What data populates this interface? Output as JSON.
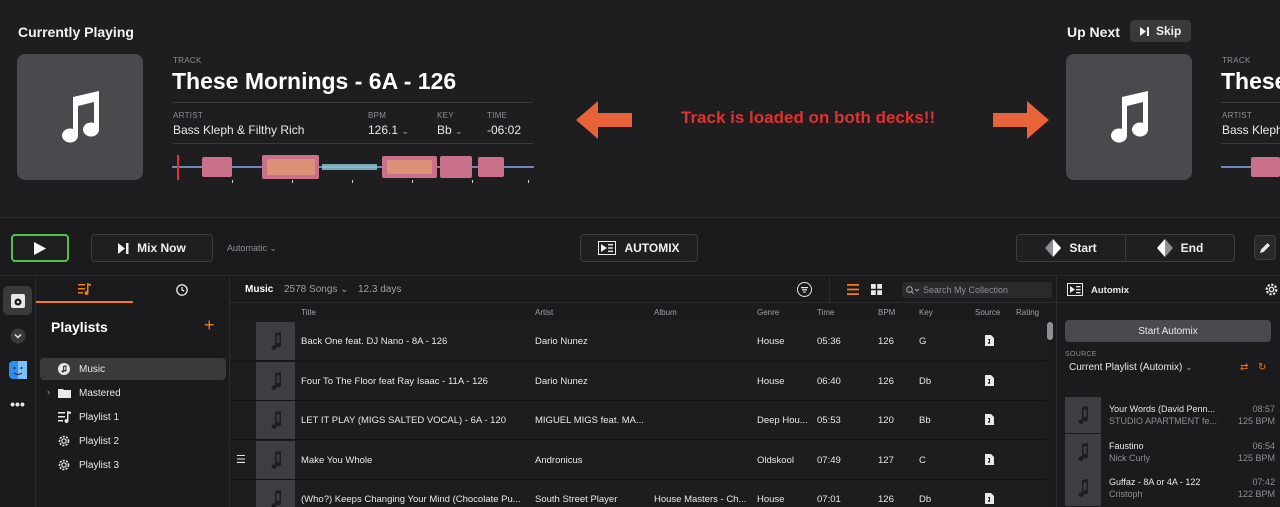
{
  "current": {
    "heading": "Currently Playing",
    "track_label": "TRACK",
    "title": "These Mornings - 6A - 126",
    "artist_label": "ARTIST",
    "artist": "Bass Kleph & Filthy Rich",
    "bpm_label": "BPM",
    "bpm": "126.1",
    "key_label": "KEY",
    "key": "Bb",
    "time_label": "TIME",
    "time": "-06:02"
  },
  "annotation": "Track is loaded on both decks!!",
  "next": {
    "heading": "Up Next",
    "skip_label": "Skip",
    "track_label": "TRACK",
    "title": "These",
    "artist_label": "ARTIST",
    "artist": "Bass Kleph"
  },
  "transport": {
    "mix_now": "Mix Now",
    "mode": "Automatic",
    "automix": "AUTOMIX",
    "start": "Start",
    "end": "End"
  },
  "playlists": {
    "heading": "Playlists",
    "items": [
      {
        "label": "Music",
        "icon": "music-note-icon"
      },
      {
        "label": "Mastered",
        "icon": "folder-icon"
      },
      {
        "label": "Playlist 1",
        "icon": "playlist-icon"
      },
      {
        "label": "Playlist 2",
        "icon": "gear-playlist-icon"
      },
      {
        "label": "Playlist 3",
        "icon": "gear-playlist-icon"
      }
    ]
  },
  "library": {
    "name": "Music",
    "song_count": "2578 Songs",
    "duration": "12.3 days",
    "search_placeholder": "Search My Collection",
    "columns": {
      "title": "Title",
      "artist": "Artist",
      "album": "Album",
      "genre": "Genre",
      "time": "Time",
      "bpm": "BPM",
      "key": "Key",
      "source": "Source",
      "rating": "Rating"
    },
    "rows": [
      {
        "title": "Back One feat. DJ Nano - 8A - 126",
        "artist": "Dario Nunez",
        "album": "",
        "genre": "House",
        "time": "05:36",
        "bpm": "126",
        "key": "G"
      },
      {
        "title": "Four To The Floor feat Ray Isaac - 11A - 126",
        "artist": "Dario Nunez",
        "album": "",
        "genre": "House",
        "time": "06:40",
        "bpm": "126",
        "key": "Db"
      },
      {
        "title": "LET IT PLAY (MIGS SALTED VOCAL) - 6A - 120",
        "artist": "MIGUEL MIGS feat. MA...",
        "album": "",
        "genre": "Deep Hou...",
        "time": "05:53",
        "bpm": "120",
        "key": "Bb"
      },
      {
        "title": "Make You Whole",
        "artist": "Andronicus",
        "album": "",
        "genre": "Oldskool",
        "time": "07:49",
        "bpm": "127",
        "key": "C"
      },
      {
        "title": "(Who?) Keeps Changing Your Mind (Chocolate Pu...",
        "artist": "South Street Player",
        "album": "House Masters - Ch...",
        "genre": "House",
        "time": "07:01",
        "bpm": "126",
        "key": "Db"
      }
    ]
  },
  "automix": {
    "heading": "Automix",
    "start_button": "Start Automix",
    "source_label": "SOURCE",
    "source": "Current Playlist (Automix)",
    "queue": [
      {
        "title": "Your Words (David Penn...",
        "artist": "STUDIO APARTMENT fe...",
        "time": "08:57",
        "bpm": "125 BPM"
      },
      {
        "title": "Faustino",
        "artist": "Nick Curly",
        "time": "06:54",
        "bpm": "125 BPM"
      },
      {
        "title": "Guffaz - 8A or 4A - 122",
        "artist": "Cristoph",
        "time": "07:42",
        "bpm": "122 BPM"
      }
    ]
  },
  "colors": {
    "accent_orange": "#f07b1d",
    "play_green": "#4fc24a",
    "annotation_red": "#e0312e",
    "arrow_orange": "#e8623a"
  }
}
